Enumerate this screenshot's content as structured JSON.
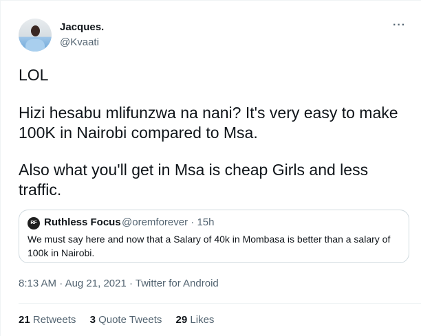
{
  "author": {
    "name": "Jacques.",
    "handle": "@Kvaati"
  },
  "tweet": {
    "lines": [
      "LOL",
      "Hizi hesabu mlifunzwa na nani?  It's very easy to make",
      "100K in Nairobi compared to Msa.",
      "Also what you'll get in Msa is cheap Girls and less",
      "traffic."
    ]
  },
  "quoted": {
    "name": "Ruthless Focus",
    "handle": "@oremforever",
    "time": "15h",
    "logo_text": "RF",
    "text": "We must say here and now that a Salary of 40k in Mombasa is better than a salary of 100k in Nairobi."
  },
  "meta": {
    "time": "8:13 AM",
    "date": "Aug 21, 2021",
    "source": "Twitter for Android"
  },
  "stats": {
    "retweets": {
      "count": "21",
      "label": "Retweets"
    },
    "quotes": {
      "count": "3",
      "label": "Quote Tweets"
    },
    "likes": {
      "count": "29",
      "label": "Likes"
    }
  }
}
